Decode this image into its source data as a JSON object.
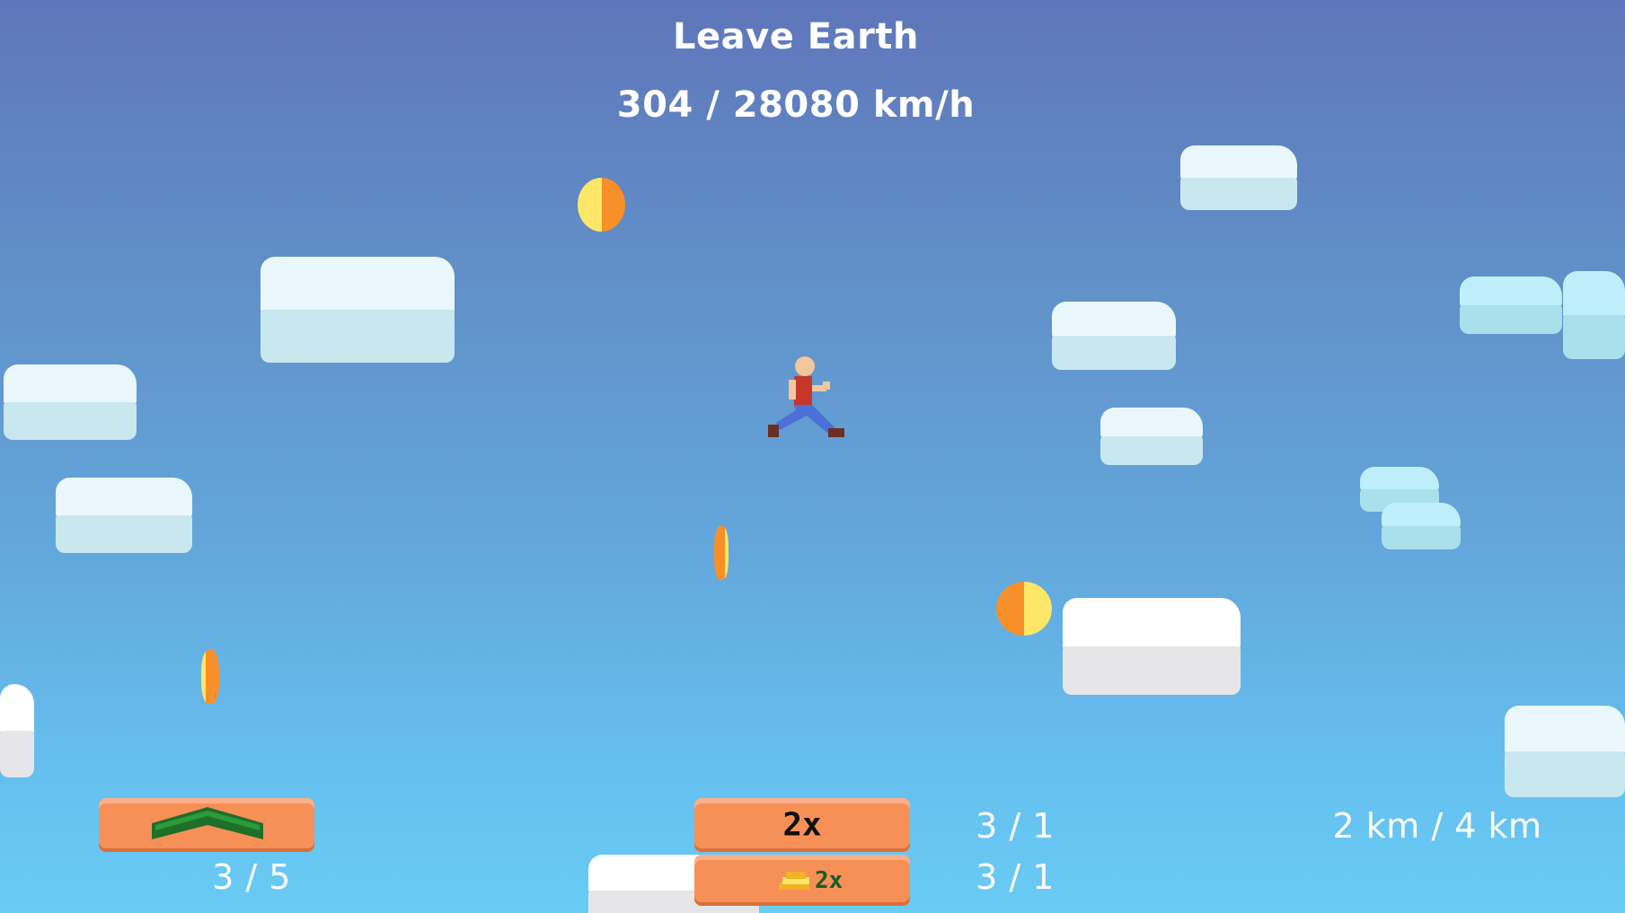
{
  "hud": {
    "title": "Leave Earth",
    "speed": "304 / 28080 km/h",
    "distance": "2 km / 4 km"
  },
  "upgrades": {
    "boost": {
      "icon": "green-chevron-icon",
      "count": "3 / 5"
    },
    "multiplier": {
      "label": "2x",
      "count": "3 / 1"
    },
    "coin_multiplier": {
      "icon": "coin-stack-icon",
      "label": "2x",
      "count": "3 / 1"
    }
  },
  "colors": {
    "sky_top": "#5f76bb",
    "sky_bottom": "#69ccf5",
    "button": "#f79057",
    "coin_orange": "#f8902a",
    "coin_yellow": "#fce769"
  }
}
